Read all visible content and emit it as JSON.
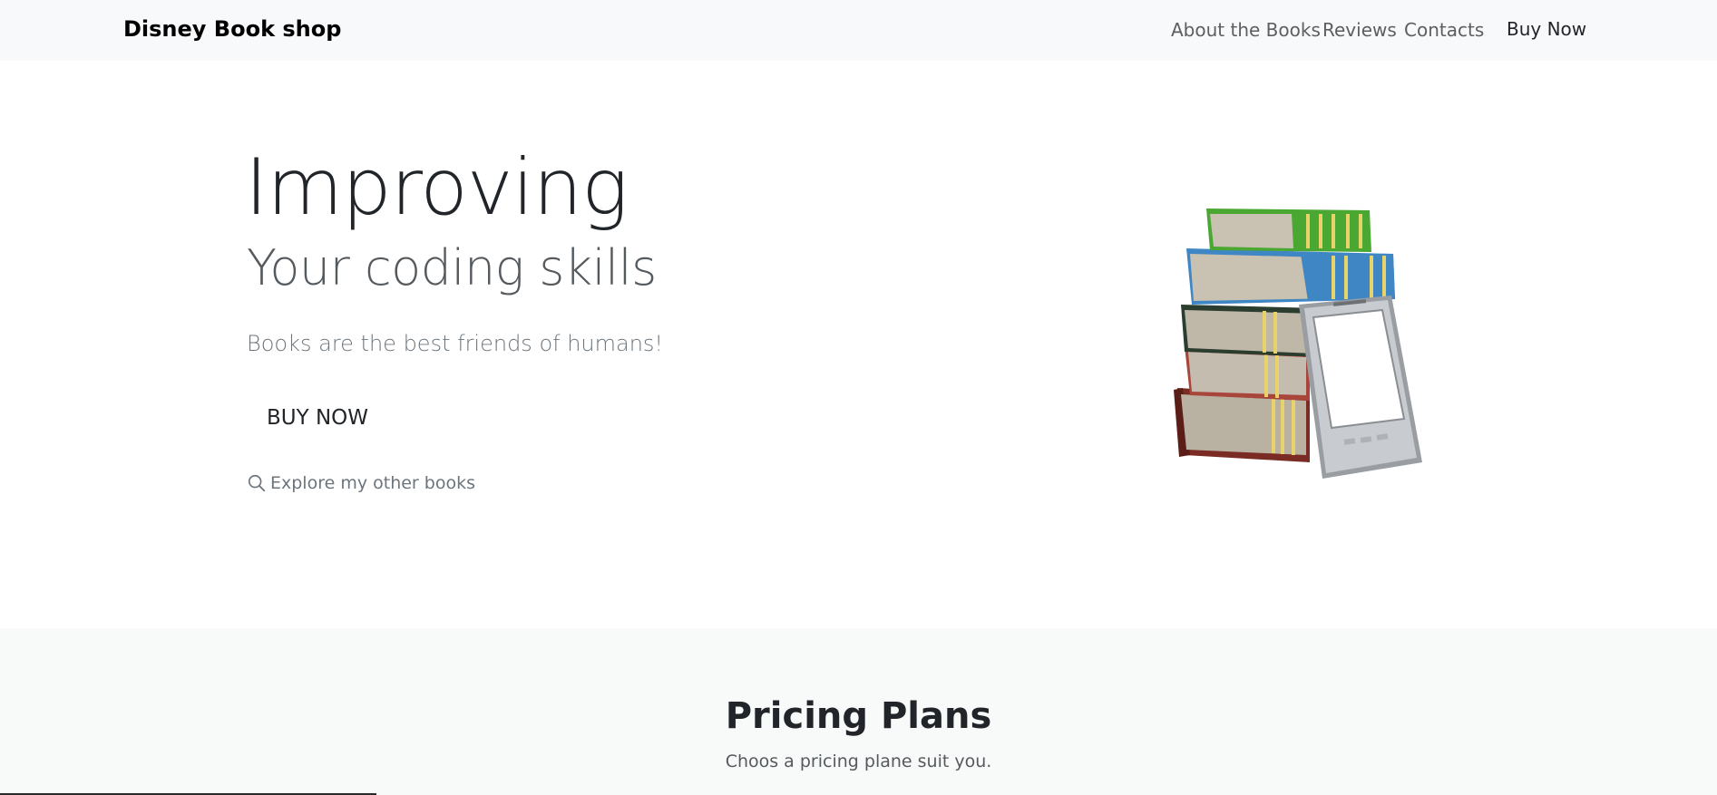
{
  "navbar": {
    "brand": "Disney Book shop",
    "links": [
      {
        "label": "About the Books"
      },
      {
        "label": "Reviews"
      },
      {
        "label": "Contacts"
      }
    ],
    "cta": "Buy Now"
  },
  "hero": {
    "title": "Improving",
    "subtitle": "Your coding skills",
    "lead": "Books are the best friends of humans!",
    "button": "BUY NOW",
    "explore_link": "Explore my other books",
    "explore_icon": "search-icon",
    "image": "books-and-ereader-illustration"
  },
  "pricing": {
    "title": "Pricing Plans",
    "subtitle": "Choos a pricing plane suit you."
  },
  "colors": {
    "navbar_bg": "#f8f9fa",
    "pricing_bg": "#f8f9f9",
    "book_green": "#4aa832",
    "book_blue": "#3e86c4",
    "book_dark_green": "#2b3d2e",
    "book_red": "#a8463c",
    "book_maroon": "#7a2b24",
    "gold_band": "#e8d36a"
  }
}
